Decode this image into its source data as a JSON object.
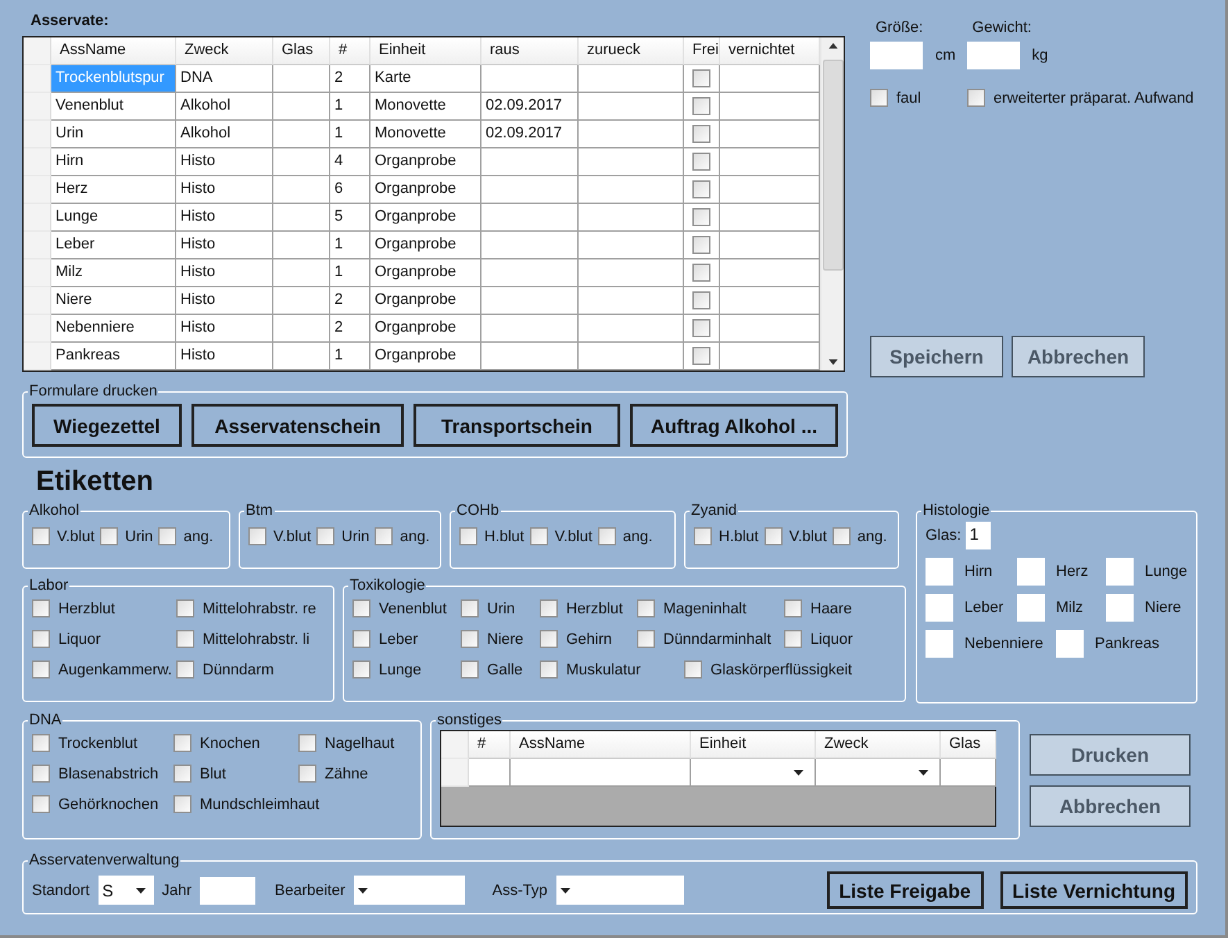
{
  "asservate": {
    "title": "Asservate:",
    "columns": [
      "AssName",
      "Zweck",
      "Glas",
      "#",
      "Einheit",
      "raus",
      "zurueck",
      "Frei",
      "vernichtet"
    ],
    "rows": [
      {
        "ass_name": "Trockenblutspur",
        "zweck": "DNA",
        "count": "2",
        "einheit": "Karte",
        "frei": false,
        "selected": true
      },
      {
        "ass_name": "Venenblut",
        "zweck": "Alkohol",
        "count": "1",
        "einheit": "Monovette",
        "raus": "02.09.2017",
        "frei": false,
        "selected": false
      },
      {
        "ass_name": "Urin",
        "zweck": "Alkohol",
        "count": "1",
        "einheit": "Monovette",
        "raus": "02.09.2017",
        "frei": false,
        "selected": false
      },
      {
        "ass_name": "Hirn",
        "zweck": "Histo",
        "count": "4",
        "einheit": "Organprobe",
        "frei": false,
        "selected": false
      },
      {
        "ass_name": "Herz",
        "zweck": "Histo",
        "count": "6",
        "einheit": "Organprobe",
        "frei": false,
        "selected": false
      },
      {
        "ass_name": "Lunge",
        "zweck": "Histo",
        "count": "5",
        "einheit": "Organprobe",
        "frei": false,
        "selected": false
      },
      {
        "ass_name": "Leber",
        "zweck": "Histo",
        "count": "1",
        "einheit": "Organprobe",
        "frei": false,
        "selected": false
      },
      {
        "ass_name": "Milz",
        "zweck": "Histo",
        "count": "1",
        "einheit": "Organprobe",
        "frei": false,
        "selected": false
      },
      {
        "ass_name": "Niere",
        "zweck": "Histo",
        "count": "2",
        "einheit": "Organprobe",
        "frei": false,
        "selected": false
      },
      {
        "ass_name": "Nebenniere",
        "zweck": "Histo",
        "count": "2",
        "einheit": "Organprobe",
        "frei": false,
        "selected": false
      },
      {
        "ass_name": "Pankreas",
        "zweck": "Histo",
        "count": "1",
        "einheit": "Organprobe",
        "frei": false,
        "selected": false
      }
    ]
  },
  "measures": {
    "fields": [
      {
        "label": "Größe:",
        "unit": "cm"
      },
      {
        "label": "Gewicht:",
        "unit": "kg"
      }
    ],
    "checkboxes": [
      {
        "label": "faul",
        "checked": false
      },
      {
        "label": "erweiterter präparat. Aufwand",
        "checked": false
      }
    ],
    "buttons": [
      {
        "label": "Speichern",
        "disabled": true
      },
      {
        "label": "Abbrechen",
        "disabled": true
      }
    ]
  },
  "formulare": {
    "title": "Formulare drucken",
    "buttons": [
      "Wiegezettel",
      "Asservatenschein",
      "Transportschein",
      "Auftrag Alkohol ..."
    ]
  },
  "etiketten": {
    "title": "Etiketten",
    "small_groups": [
      {
        "title": "Alkohol",
        "items": [
          {
            "label": "V.blut",
            "checked": false
          },
          {
            "label": "Urin",
            "checked": false
          },
          {
            "label": "ang.",
            "checked": false
          }
        ]
      },
      {
        "title": "Btm",
        "items": [
          {
            "label": "V.blut",
            "checked": false
          },
          {
            "label": "Urin",
            "checked": false
          },
          {
            "label": "ang.",
            "checked": false
          }
        ]
      },
      {
        "title": "COHb",
        "items": [
          {
            "label": "H.blut",
            "checked": false
          },
          {
            "label": "V.blut",
            "checked": false
          },
          {
            "label": "ang.",
            "checked": false
          }
        ]
      },
      {
        "title": "Zyanid",
        "items": [
          {
            "label": "H.blut",
            "checked": false
          },
          {
            "label": "V.blut",
            "checked": false
          },
          {
            "label": "ang.",
            "checked": false
          }
        ]
      }
    ],
    "labor": {
      "title": "Labor",
      "items": [
        {
          "label": "Herzblut",
          "checked": false
        },
        {
          "label": "Mittelohrabstr. re",
          "checked": false
        },
        {
          "label": "Liquor",
          "checked": false
        },
        {
          "label": "Mittelohrabstr. li",
          "checked": false
        },
        {
          "label": "Augenkammerw.",
          "checked": false
        },
        {
          "label": "Dünndarm",
          "checked": false
        }
      ]
    },
    "toxikologie": {
      "title": "Toxikologie",
      "items": [
        {
          "label": "Venenblut",
          "checked": false
        },
        {
          "label": "Urin",
          "checked": false
        },
        {
          "label": "Herzblut",
          "checked": false
        },
        {
          "label": "Mageninhalt",
          "checked": false
        },
        {
          "label": "Haare",
          "checked": false
        },
        {
          "label": "Leber",
          "checked": false
        },
        {
          "label": "Niere",
          "checked": false
        },
        {
          "label": "Gehirn",
          "checked": false
        },
        {
          "label": "Dünndarminhalt",
          "checked": false
        },
        {
          "label": "Liquor",
          "checked": false
        },
        {
          "label": "Lunge",
          "checked": false
        },
        {
          "label": "Galle",
          "checked": false
        },
        {
          "label": "Muskulatur",
          "checked": false
        },
        {
          "label": "Glaskörperflüssigkeit",
          "checked": false
        }
      ]
    },
    "histologie": {
      "title": "Histologie",
      "glas_label": "Glas:",
      "glas_value": "1",
      "items": [
        "Hirn",
        "Herz",
        "Lunge",
        "Leber",
        "Milz",
        "Niere",
        "Nebenniere",
        "Pankreas"
      ]
    },
    "dna": {
      "title": "DNA",
      "items": [
        {
          "label": "Trockenblut",
          "checked": false
        },
        {
          "label": "Knochen",
          "checked": false
        },
        {
          "label": "Nagelhaut",
          "checked": false
        },
        {
          "label": "Blasenabstrich",
          "checked": false
        },
        {
          "label": "Blut",
          "checked": false
        },
        {
          "label": "Zähne",
          "checked": false
        },
        {
          "label": "Gehörknochen",
          "checked": false
        },
        {
          "label": "Mundschleimhaut",
          "checked": false
        }
      ]
    },
    "sonstiges": {
      "title": "sonstiges",
      "columns": [
        "#",
        "AssName",
        "Einheit",
        "Zweck",
        "Glas"
      ]
    },
    "buttons": [
      {
        "label": "Drucken",
        "disabled": true
      },
      {
        "label": "Abbrechen",
        "disabled": true
      }
    ]
  },
  "verwaltung": {
    "title": "Asservatenverwaltung",
    "standort_label": "Standort",
    "standort_value": "S",
    "jahr_label": "Jahr",
    "bearbeiter_label": "Bearbeiter",
    "asstyp_label": "Ass-Typ",
    "buttons": [
      "Liste Freigabe",
      "Liste Vernichtung"
    ]
  }
}
